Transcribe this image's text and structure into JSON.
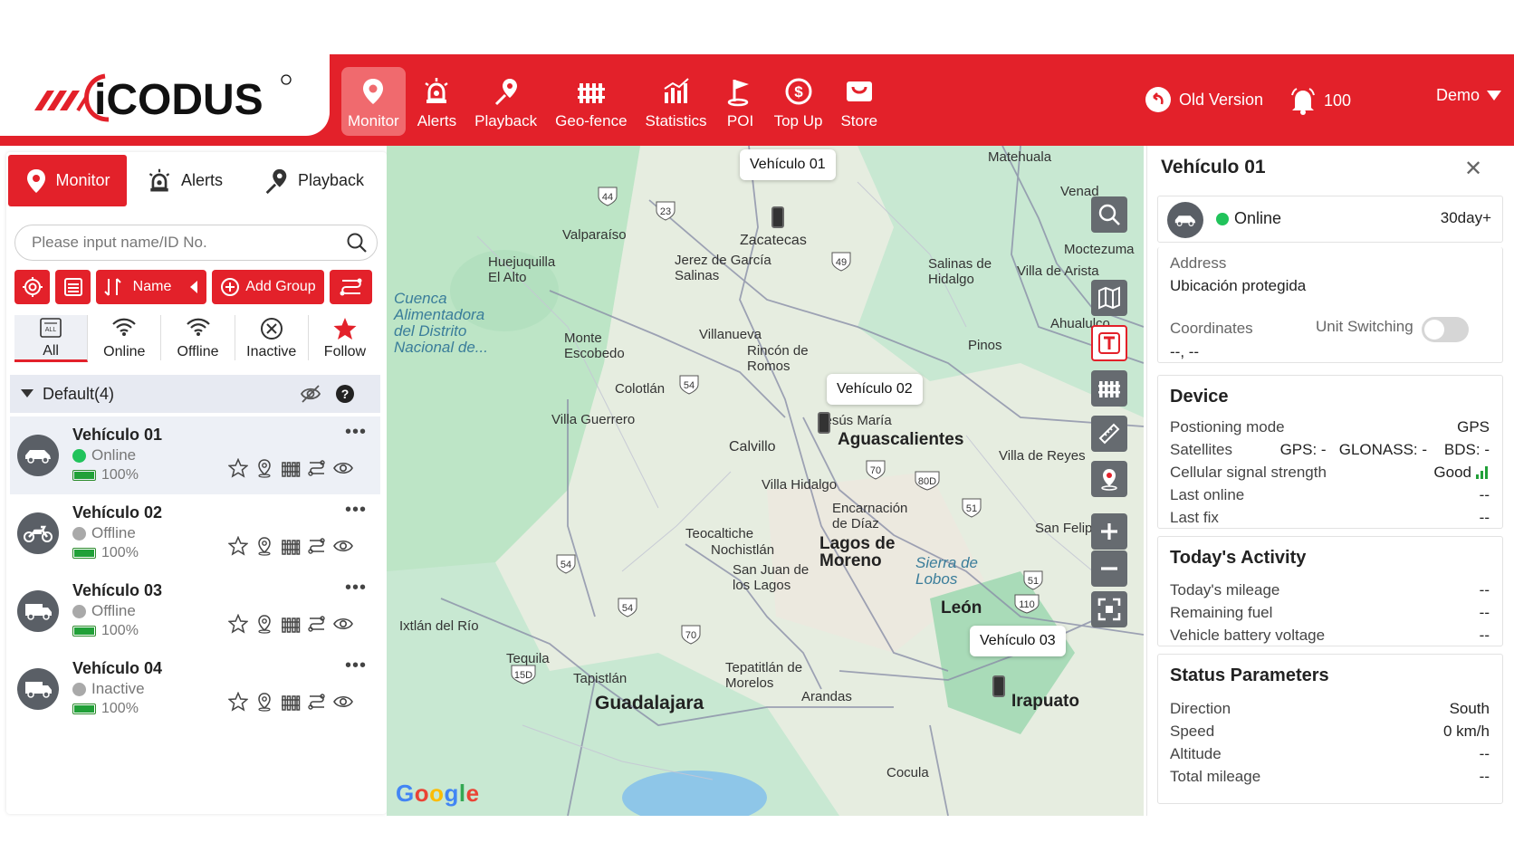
{
  "brand": {
    "logo_text": "MICODUS"
  },
  "colors": {
    "accent": "#e3212a",
    "online": "#21c35b",
    "offline": "#a9a9a9",
    "battery": "#21a038"
  },
  "nav": [
    {
      "label": "Monitor",
      "icon": "map-pin-icon"
    },
    {
      "label": "Alerts",
      "icon": "alarm-icon"
    },
    {
      "label": "Playback",
      "icon": "route-pin-icon"
    },
    {
      "label": "Geo-fence",
      "icon": "fence-icon"
    },
    {
      "label": "Statistics",
      "icon": "bar-chart-icon"
    },
    {
      "label": "POI",
      "icon": "flag-icon"
    },
    {
      "label": "Top Up",
      "icon": "dollar-icon"
    },
    {
      "label": "Store",
      "icon": "cart-icon"
    }
  ],
  "header": {
    "old_version": "Old Version",
    "notifications": "100",
    "user": "Demo"
  },
  "left_tabs": [
    "Monitor",
    "Alerts",
    "Playback"
  ],
  "search": {
    "placeholder": "Please input name/ID No.",
    "value": ""
  },
  "toolbar": {
    "sort_label": "Name",
    "add_group_label": "Add Group"
  },
  "filters": [
    "All",
    "Online",
    "Offline",
    "Inactive",
    "Follow"
  ],
  "group": {
    "label": "Default(4)"
  },
  "vehicles": [
    {
      "name": "Vehículo 01",
      "status": "Online",
      "battery": "100%",
      "icon": "car-icon"
    },
    {
      "name": "Vehículo 02",
      "status": "Offline",
      "battery": "100%",
      "icon": "motorcycle-icon"
    },
    {
      "name": "Vehículo 03",
      "status": "Offline",
      "battery": "100%",
      "icon": "truck-icon"
    },
    {
      "name": "Vehículo 04",
      "status": "Inactive",
      "battery": "100%",
      "icon": "truck-icon"
    }
  ],
  "map": {
    "callouts": [
      "Vehículo 01",
      "Vehículo 02",
      "Vehículo 03"
    ],
    "places": [
      "Matehuala",
      "Venad",
      "Moctezuma",
      "Valparaíso",
      "Zacatecas",
      "Huejuquilla El Alto",
      "Jerez de García Salinas",
      "Salinas de Hidalgo",
      "Villa de Arista",
      "Ahualulco",
      "Pinos",
      "Villanueva",
      "Rincón de Romos",
      "Monte Escobedo",
      "Colotlán",
      "Villa Guerrero",
      "Jesús María",
      "Aguascalientes",
      "Calvillo",
      "Villa de Reyes",
      "Villa Hidalgo",
      "Encarnación de Díaz",
      "Teocaltiche",
      "Nochistlán",
      "Lagos de Moreno",
      "San Juan de los Lagos",
      "San Felipe",
      "León",
      "Ixtlán del Río",
      "Tequila",
      "Tapistlán",
      "Tepatitlán de Morelos",
      "Arandas",
      "Guadalajara",
      "Irapuato",
      "Cocula",
      "Cuenca Alimentadora del Distrito Nacional de...",
      "Sierra de Lobos"
    ],
    "highways": [
      "44",
      "23",
      "49",
      "54",
      "70",
      "80D",
      "51",
      "54",
      "54",
      "70",
      "15D",
      "51",
      "110"
    ],
    "attribution": "Google"
  },
  "detail": {
    "title": "Vehículo 01",
    "status": "Online",
    "plan": "30day+",
    "address_label": "Address",
    "address_value": "Ubicación protegida",
    "coordinates_label": "Coordinates",
    "coordinates_value": "--, --",
    "unit_switching_label": "Unit Switching",
    "unit_switching_on": false,
    "device": {
      "title": "Device",
      "rows": [
        {
          "k": "Postioning mode",
          "v": "GPS"
        },
        {
          "k": "Satellites",
          "v": "GPS: -   GLONASS: -    BDS: -"
        },
        {
          "k": "Cellular signal strength",
          "v": "Good"
        },
        {
          "k": "Last online",
          "v": "--"
        },
        {
          "k": "Last fix",
          "v": "--"
        }
      ]
    },
    "activity": {
      "title": "Today's Activity",
      "rows": [
        {
          "k": "Today's mileage",
          "v": "--"
        },
        {
          "k": "Remaining fuel",
          "v": "--"
        },
        {
          "k": "Vehicle battery voltage",
          "v": "--"
        }
      ]
    },
    "status_params": {
      "title": "Status Parameters",
      "rows": [
        {
          "k": "Direction",
          "v": "South"
        },
        {
          "k": "Speed",
          "v": "0 km/h"
        },
        {
          "k": "Altitude",
          "v": "--"
        },
        {
          "k": "Total mileage",
          "v": "--"
        }
      ]
    }
  }
}
